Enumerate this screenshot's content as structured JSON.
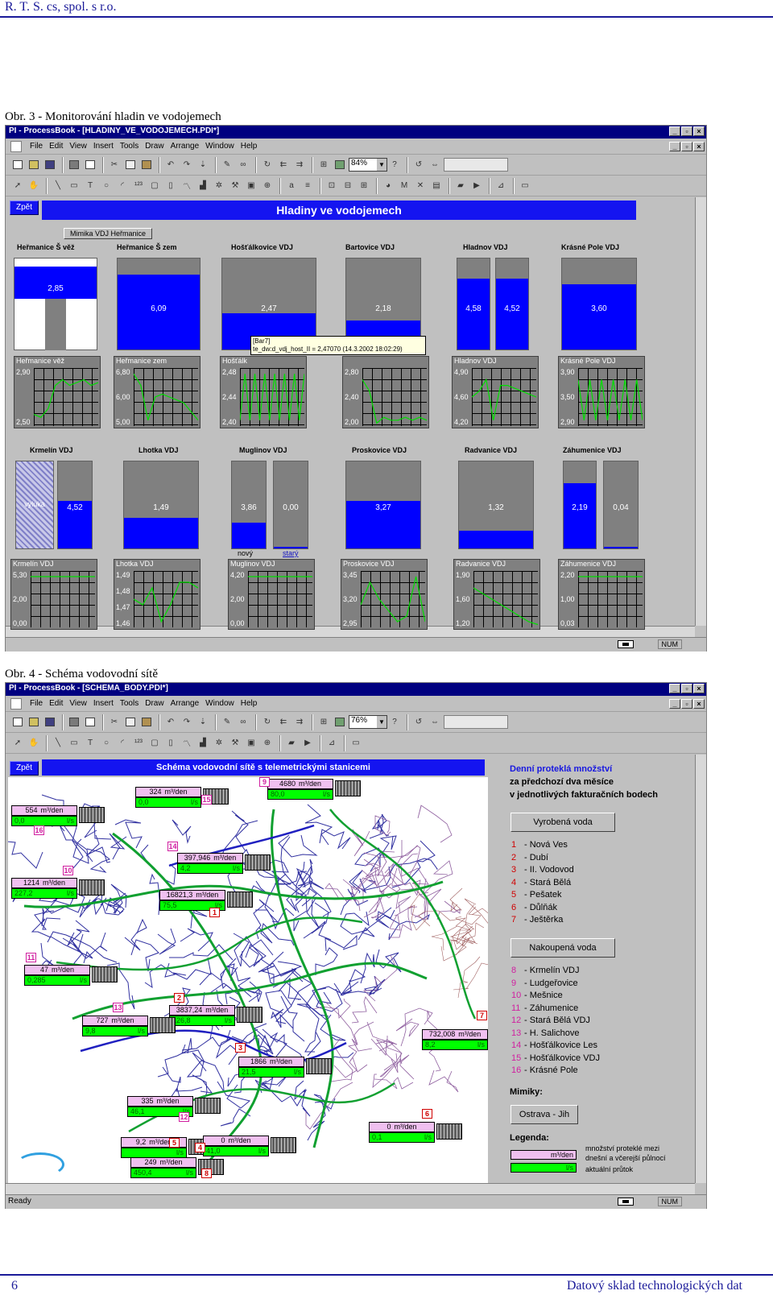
{
  "page": {
    "header": "R. T. S. cs, spol. s r.o.",
    "figure3_caption": "Obr. 3 - Monitorování hladin ve vodojemech",
    "figure4_caption": "Obr. 4 - Schéma vodovodní sítě",
    "page_number": "6",
    "footer_title": "Datový sklad technologických dat"
  },
  "menu": [
    "File",
    "Edit",
    "View",
    "Insert",
    "Tools",
    "Draw",
    "Arrange",
    "Window",
    "Help"
  ],
  "win1": {
    "title": "PI - ProcessBook - [HLADINY_VE_VODOJEMECH.PDI*]",
    "zoom": "84%",
    "back_button": "Zpět",
    "banner": "Hladiny ve vodojemech",
    "mimic_button": "Mimika VDJ Heřmanice",
    "tooltip_line1": "[Bar7]",
    "tooltip_line2": "te_dw:d_vdj_host_II = 2,47070 (14.3.2002 18:02:29)",
    "status_num": "NUM",
    "labels_row1": [
      "Heřmanice Š věž",
      "Heřmanice Š zem",
      "Hošťálkovice VDJ",
      "Bartovice VDJ",
      "Hladnov VDJ",
      "Krásné Pole VDJ"
    ],
    "labels_row2": [
      "Krmelín VDJ",
      "Lhotka VDJ",
      "Muglinov VDJ",
      "Proskovice VDJ",
      "Radvanice VDJ",
      "Záhumenice VDJ"
    ],
    "tank_values_row1": [
      "2,85",
      "6,09",
      "2,47",
      "2,18",
      "4,58",
      "4,52",
      "3,60"
    ],
    "tank_values_row2": [
      "4,52",
      "1,49",
      "3,86",
      "0,00",
      "3,27",
      "1,32",
      "2,19",
      "0,04"
    ],
    "tank_fill_row1": [
      0.35,
      0.82,
      0.4,
      0.32,
      0.78,
      0.78,
      0.72
    ],
    "tank_fill_row2": [
      0.55,
      0.35,
      0.3,
      0.02,
      0.55,
      0.2,
      0.75,
      0.02
    ],
    "vyluka": "vyluka",
    "muglinov_novy": "nový",
    "muglinov_stary": "starý",
    "trends_row1": [
      {
        "title": "Heřmanice věž",
        "v": [
          "2,90",
          "",
          "2,50"
        ]
      },
      {
        "title": "Heřmanice zem",
        "v": [
          "6,80",
          "6,00",
          "5,00"
        ]
      },
      {
        "title": "Hošťálk",
        "v": [
          "2,48",
          "2,44",
          "2,40"
        ]
      },
      {
        "title": "",
        "v": [
          "2,80",
          "2,40",
          "2,00"
        ]
      },
      {
        "title": "Hladnov VDJ",
        "v": [
          "4,90",
          "4,60",
          "4,20"
        ]
      },
      {
        "title": "Krásné Pole VDJ",
        "v": [
          "3,90",
          "3,50",
          "2,90"
        ]
      }
    ],
    "trends_row2": [
      {
        "title": "Krmelín VDJ",
        "v": [
          "5,30",
          "2,00",
          "0,00"
        ]
      },
      {
        "title": "Lhotka VDJ",
        "v": [
          "1,49",
          "1,48",
          "1,47",
          "1,46"
        ]
      },
      {
        "title": "Muglinov VDJ",
        "v": [
          "4,20",
          "2,00",
          "0,00"
        ]
      },
      {
        "title": "Proskovice VDJ",
        "v": [
          "3,45",
          "3,20",
          "2,95"
        ]
      },
      {
        "title": "Radvanice VDJ",
        "v": [
          "1,90",
          "1,60",
          "1,20"
        ]
      },
      {
        "title": "Záhumenice VDJ",
        "v": [
          "2,20",
          "1,00",
          "0,03"
        ]
      }
    ]
  },
  "win2": {
    "title": "PI - ProcessBook - [SCHEMA_BODY.PDI*]",
    "zoom": "76%",
    "back_button": "Zpět",
    "banner": "Schéma vodovodní sítě s telemetrickými stanicemi",
    "status_ready": "Ready",
    "status_num": "NUM",
    "panel_title1": "Denní proteklá množství",
    "panel_title2": "za předchozí dva měsíce",
    "panel_title3": "v jednotlivých fakturačních bodech",
    "btn_vyrobena": "Vyrobená voda",
    "btn_nakoupena": "Nakoupená voda",
    "btn_ostrava": "Ostrava - Jih",
    "mimiky": "Mimiky:",
    "legenda": "Legenda:",
    "legend_unit1": "m³/den",
    "legend_unit2": "l/s",
    "legend_text": [
      "množství proteklé mezi",
      "dnešní a včerejší půlnocí",
      "aktuální průtok"
    ],
    "list_vyrobena": [
      {
        "n": "1",
        "t": "Nová Ves"
      },
      {
        "n": "2",
        "t": "Dubí"
      },
      {
        "n": "3",
        "t": "II. Vodovod"
      },
      {
        "n": "4",
        "t": "Stará Bělá"
      },
      {
        "n": "5",
        "t": "Pešatek"
      },
      {
        "n": "6",
        "t": "Důlňák"
      },
      {
        "n": "7",
        "t": "Ještěrka"
      }
    ],
    "list_nakoupena": [
      {
        "n": "8",
        "t": "Krmelín VDJ"
      },
      {
        "n": "9",
        "t": "Ludgeřovice"
      },
      {
        "n": "10",
        "t": "Mešnice"
      },
      {
        "n": "11",
        "t": "Záhumenice"
      },
      {
        "n": "12",
        "t": "Stará Bělá VDJ"
      },
      {
        "n": "13",
        "t": "H. Salichove"
      },
      {
        "n": "14",
        "t": "Hošťálkovice Les"
      },
      {
        "n": "15",
        "t": "Hošťálkovice VDJ"
      },
      {
        "n": "16",
        "t": "Krásné Pole"
      }
    ],
    "stations": [
      {
        "a": "554",
        "b": "0,0",
        "num": "16"
      },
      {
        "a": "324",
        "b": "0,0",
        "num": "15"
      },
      {
        "a": "4680",
        "b": "80,0",
        "num": "9"
      },
      {
        "a": "397,946",
        "b": "4,2",
        "num": "14"
      },
      {
        "a": "1214",
        "b": "227,2",
        "num": "10"
      },
      {
        "a": "16821,3",
        "b": "75,5",
        "num": "1"
      },
      {
        "a": "47",
        "b": "0,285",
        "num": "11"
      },
      {
        "a": "3837,24",
        "b": "126,8",
        "num": "2"
      },
      {
        "a": "727",
        "b": "9,8",
        "num": "13"
      },
      {
        "a": "732,008",
        "b": "8,2",
        "num": "7"
      },
      {
        "a": "1866",
        "b": "21,5",
        "num": "3"
      },
      {
        "a": "335",
        "b": "46,1",
        "num": "12"
      },
      {
        "a": "9,2",
        "b": "",
        "num": "5"
      },
      {
        "a": "0",
        "b": "41,0",
        "num": "4"
      },
      {
        "a": "0",
        "b": "0,1",
        "num": "6"
      },
      {
        "a": "249",
        "b": "450,4",
        "num": "8"
      }
    ],
    "unit_day": "m³/den",
    "unit_flow": "l/s"
  }
}
